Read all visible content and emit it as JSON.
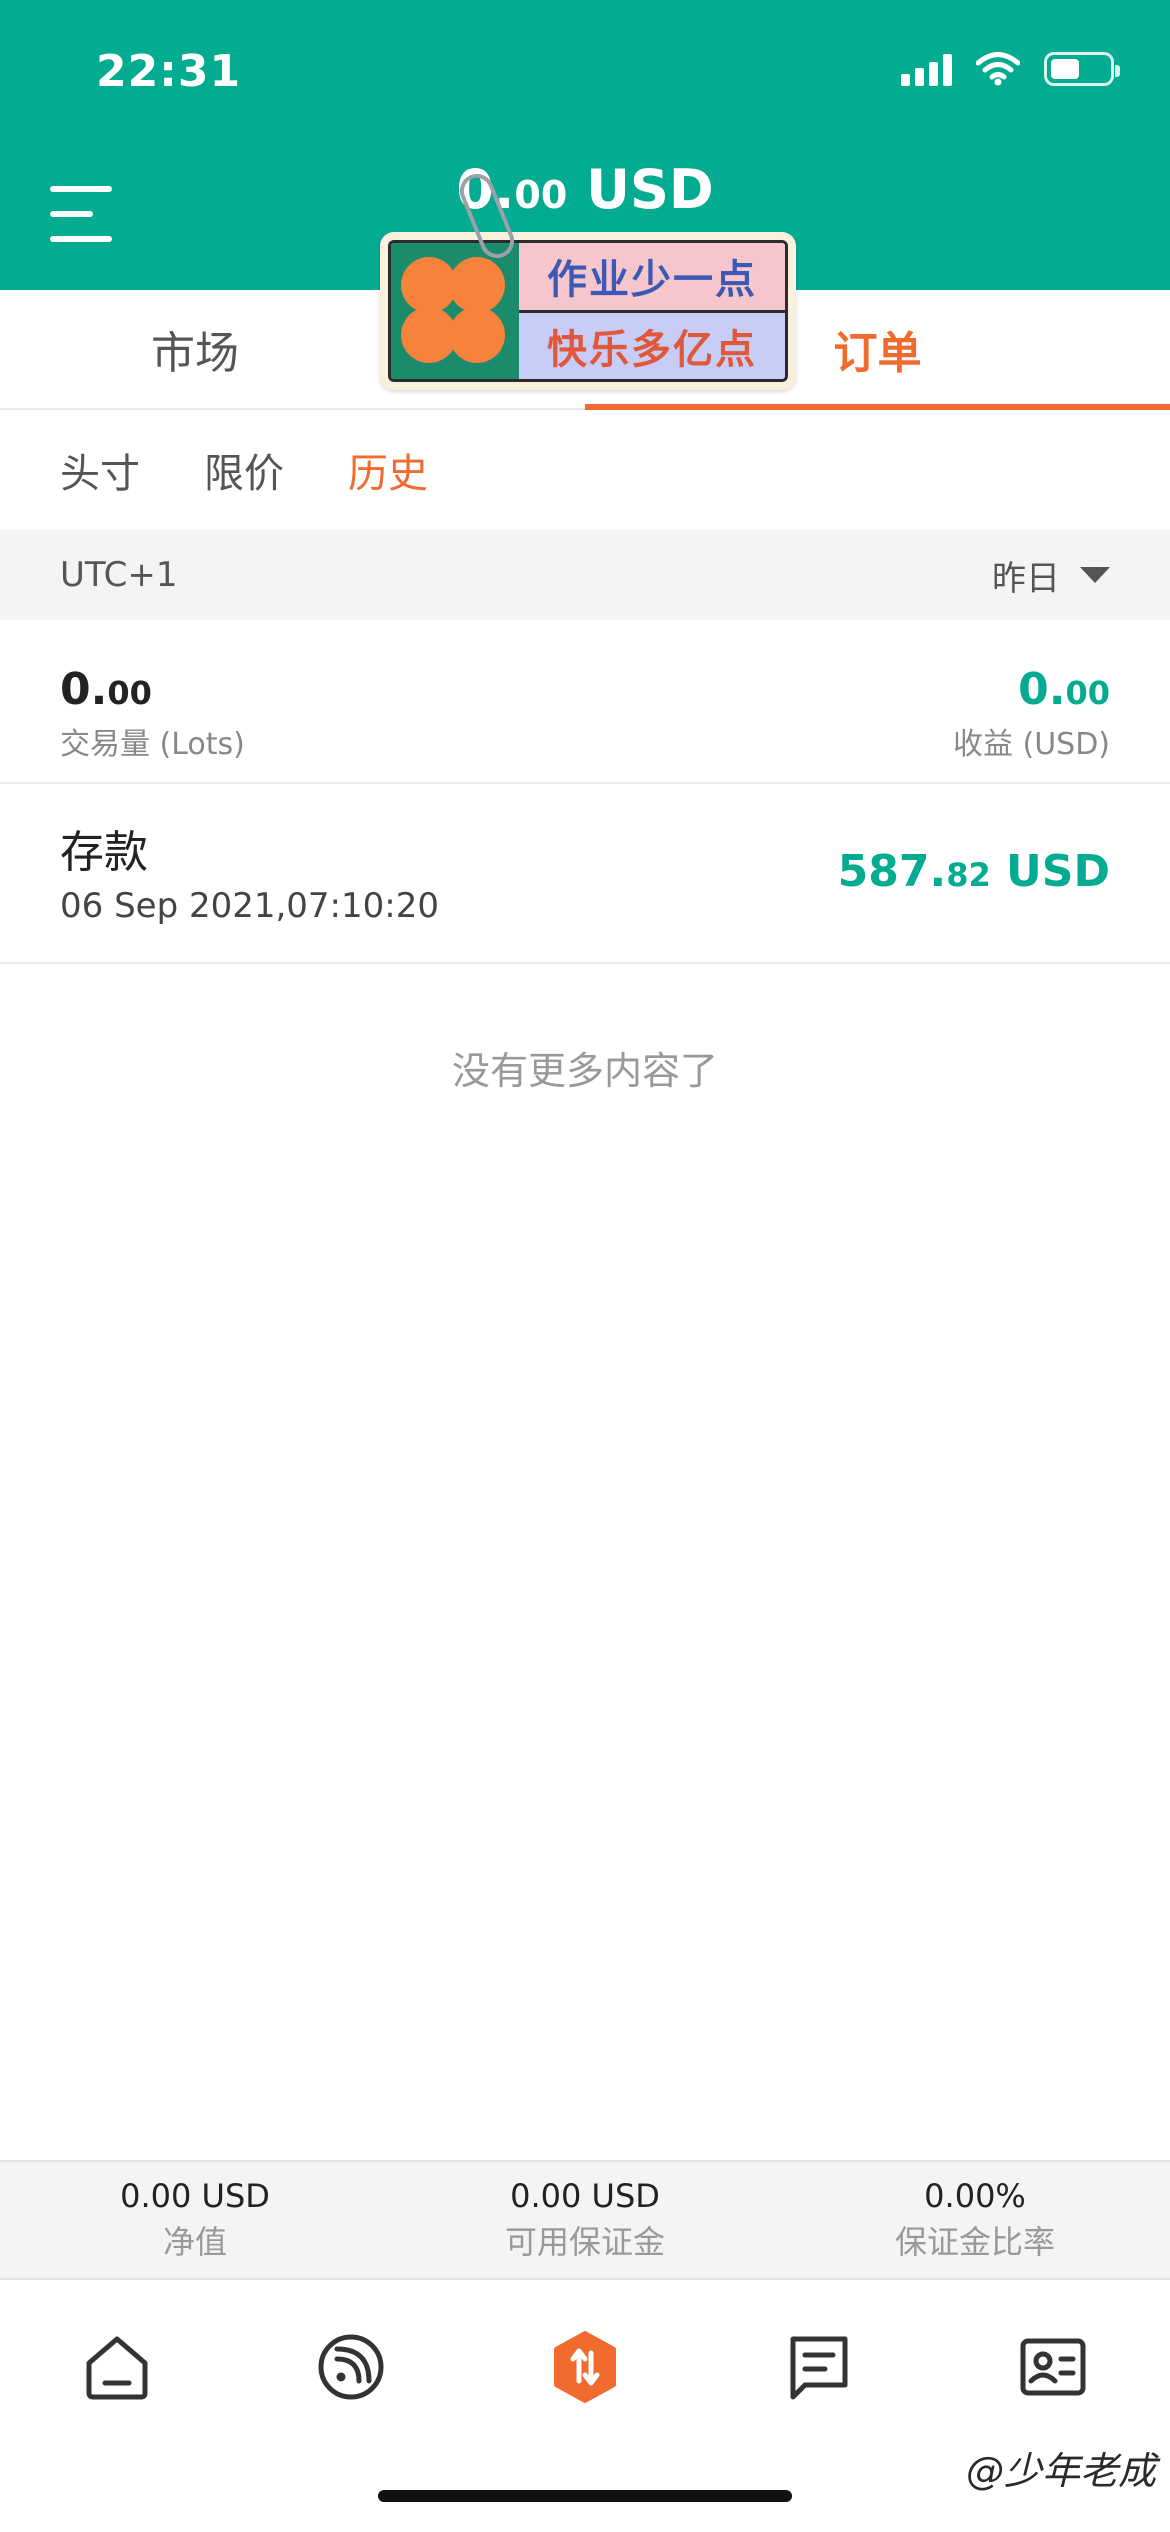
{
  "status_bar": {
    "time": "22:31"
  },
  "header": {
    "balance_main": "0.",
    "balance_decimal": "00",
    "balance_currency": " USD"
  },
  "tabs": [
    {
      "label": "市场"
    },
    {
      "label": "订单"
    }
  ],
  "sticker": {
    "line1": "作业少一点",
    "line2": "快乐多亿点"
  },
  "subtabs": [
    {
      "label": "头寸"
    },
    {
      "label": "限价"
    },
    {
      "label": "历史"
    }
  ],
  "filter": {
    "timezone": "UTC+1",
    "period": "昨日"
  },
  "summary": {
    "volume_main": "0.",
    "volume_decimal": "00",
    "volume_label": "交易量 (Lots)",
    "profit_main": "0.",
    "profit_decimal": "00",
    "profit_label": "收益 (USD)"
  },
  "history": [
    {
      "title": "存款",
      "datetime": "06 Sep 2021,07:10:20",
      "amount_main": "587.",
      "amount_decimal": "82",
      "amount_currency": " USD"
    }
  ],
  "empty_text": "没有更多内容了",
  "account_stats": [
    {
      "value": "0.00 USD",
      "label": "净值"
    },
    {
      "value": "0.00 USD",
      "label": "可用保证金"
    },
    {
      "value": "0.00%",
      "label": "保证金比率"
    }
  ],
  "bottom_nav": [
    {
      "icon": "home-icon"
    },
    {
      "icon": "feed-icon"
    },
    {
      "icon": "trade-icon"
    },
    {
      "icon": "chat-icon"
    },
    {
      "icon": "profile-card-icon"
    }
  ],
  "watermark": "@少年老成",
  "colors": {
    "brand_green": "#03ab91",
    "accent_orange": "#f26b2e"
  }
}
